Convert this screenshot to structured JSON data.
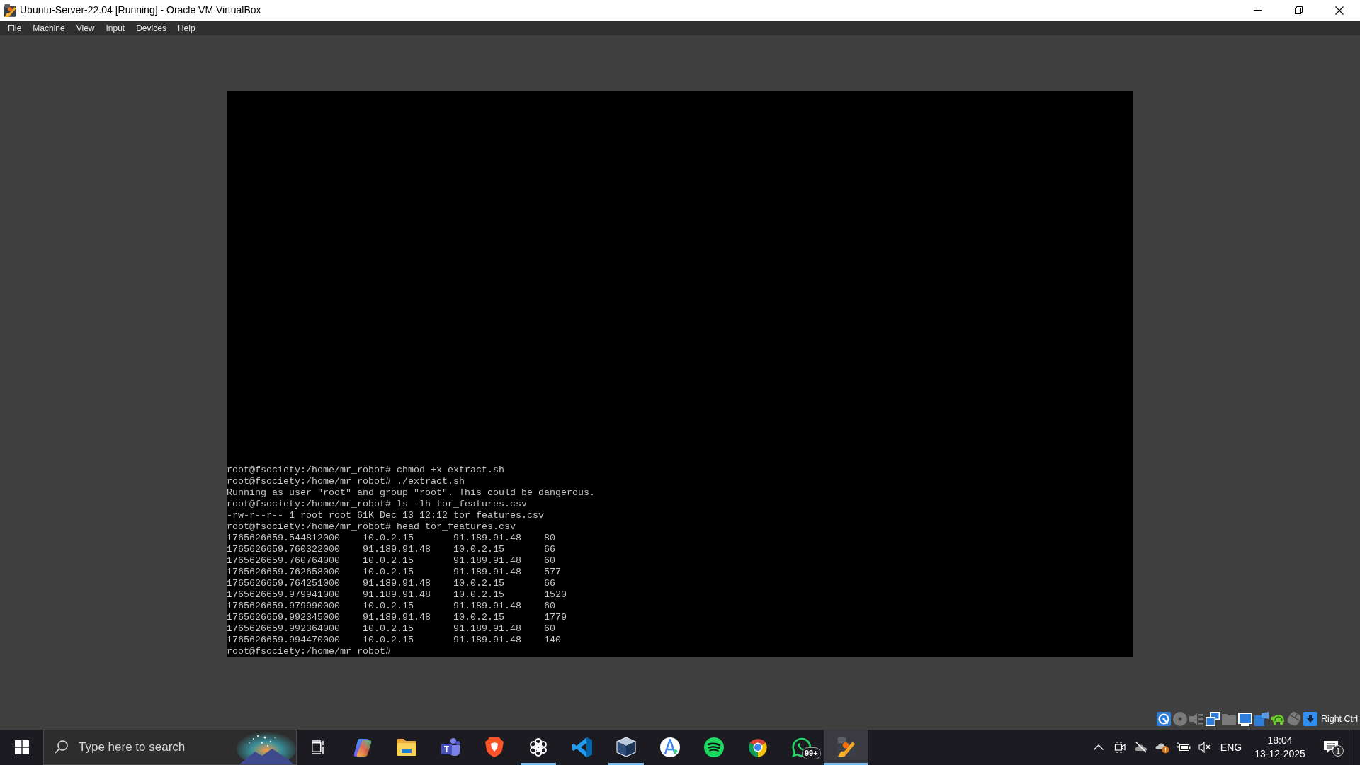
{
  "window": {
    "title": "Ubuntu-Server-22.04 [Running] - Oracle VM VirtualBox"
  },
  "menu": [
    "File",
    "Machine",
    "View",
    "Input",
    "Devices",
    "Help"
  ],
  "terminal": {
    "lines": [
      "root@fsociety:/home/mr_robot# chmod +x extract.sh",
      "root@fsociety:/home/mr_robot# ./extract.sh",
      "Running as user \"root\" and group \"root\". This could be dangerous.",
      "root@fsociety:/home/mr_robot# ls -lh tor_features.csv",
      "-rw-r--r-- 1 root root 61K Dec 13 12:12 tor_features.csv",
      "root@fsociety:/home/mr_robot# head tor_features.csv"
    ],
    "csv_rows": [
      [
        "1765626659.544812000",
        "10.0.2.15",
        "91.189.91.48",
        "80"
      ],
      [
        "1765626659.760322000",
        "91.189.91.48",
        "10.0.2.15",
        "66"
      ],
      [
        "1765626659.760764000",
        "10.0.2.15",
        "91.189.91.48",
        "60"
      ],
      [
        "1765626659.762658000",
        "10.0.2.15",
        "91.189.91.48",
        "577"
      ],
      [
        "1765626659.764251000",
        "91.189.91.48",
        "10.0.2.15",
        "66"
      ],
      [
        "1765626659.979941000",
        "91.189.91.48",
        "10.0.2.15",
        "1520"
      ],
      [
        "1765626659.979990000",
        "10.0.2.15",
        "91.189.91.48",
        "60"
      ],
      [
        "1765626659.992345000",
        "91.189.91.48",
        "10.0.2.15",
        "1779"
      ],
      [
        "1765626659.992364000",
        "10.0.2.15",
        "91.189.91.48",
        "60"
      ],
      [
        "1765626659.994470000",
        "10.0.2.15",
        "91.189.91.48",
        "140"
      ]
    ],
    "prompt": "root@fsociety:/home/mr_robot#"
  },
  "status_bar": {
    "indicators": [
      {
        "active": true
      },
      {
        "active": false
      },
      {
        "active": false
      },
      {
        "active": true
      },
      {
        "active": false
      },
      {
        "active": true
      },
      {
        "active": true
      },
      {
        "active": true
      },
      {
        "active": false
      },
      {
        "active": true
      }
    ],
    "host_key": "Right Ctrl"
  },
  "taskbar": {
    "search": {
      "placeholder": "Type here to search"
    },
    "apps": [
      {
        "running": false,
        "selected": false
      },
      {
        "running": false,
        "selected": false
      },
      {
        "running": false,
        "selected": false
      },
      {
        "running": false,
        "selected": false
      },
      {
        "running": true,
        "selected": false
      },
      {
        "running": false,
        "selected": false
      },
      {
        "running": true,
        "selected": false
      },
      {
        "running": false,
        "selected": false
      },
      {
        "running": false,
        "selected": false
      },
      {
        "running": false,
        "selected": false
      },
      {
        "running": false,
        "selected": false,
        "badge": "99+"
      },
      {
        "running": true,
        "selected": true
      }
    ],
    "tray": {
      "language": "ENG",
      "time": "18:04",
      "date": "13-12-2025",
      "notifications": "1"
    }
  }
}
